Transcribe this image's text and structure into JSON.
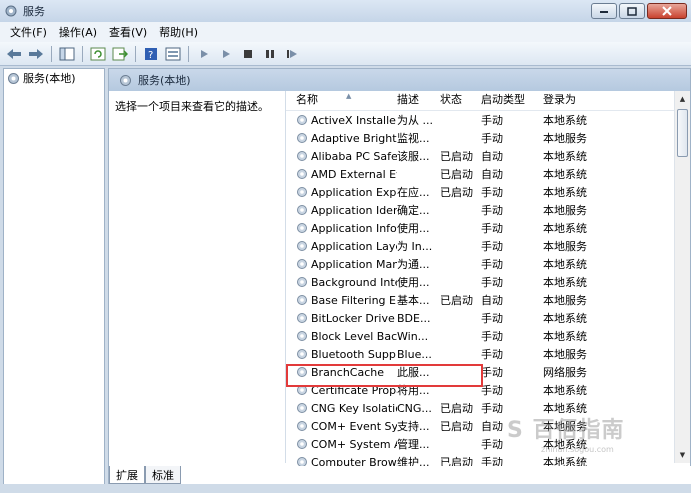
{
  "window": {
    "title": "服务"
  },
  "menu": [
    "文件(F)",
    "操作(A)",
    "查看(V)",
    "帮助(H)"
  ],
  "tree": {
    "root_label": "服务(本地)"
  },
  "pane": {
    "header_label": "服务(本地)",
    "description_prompt": "选择一个项目来查看它的描述。"
  },
  "columns": {
    "name": "名称",
    "desc": "描述",
    "state": "状态",
    "startup": "启动类型",
    "logon": "登录为"
  },
  "services": [
    {
      "name": "ActiveX Installer ...",
      "desc": "为从 ...",
      "state": "",
      "startup": "手动",
      "logon": "本地系统"
    },
    {
      "name": "Adaptive Brightn...",
      "desc": "监视...",
      "state": "",
      "startup": "手动",
      "logon": "本地服务"
    },
    {
      "name": "Alibaba PC Safe ...",
      "desc": "该服...",
      "state": "已启动",
      "startup": "自动",
      "logon": "本地系统"
    },
    {
      "name": "AMD External Ev...",
      "desc": "",
      "state": "已启动",
      "startup": "自动",
      "logon": "本地系统"
    },
    {
      "name": "Application Expe...",
      "desc": "在应...",
      "state": "已启动",
      "startup": "手动",
      "logon": "本地系统"
    },
    {
      "name": "Application Iden...",
      "desc": "确定...",
      "state": "",
      "startup": "手动",
      "logon": "本地服务"
    },
    {
      "name": "Application Infor...",
      "desc": "使用...",
      "state": "",
      "startup": "手动",
      "logon": "本地系统"
    },
    {
      "name": "Application Laye...",
      "desc": "为 In...",
      "state": "",
      "startup": "手动",
      "logon": "本地服务"
    },
    {
      "name": "Application Man...",
      "desc": "为通...",
      "state": "",
      "startup": "手动",
      "logon": "本地系统"
    },
    {
      "name": "Background Inte...",
      "desc": "使用...",
      "state": "",
      "startup": "手动",
      "logon": "本地系统"
    },
    {
      "name": "Base Filtering En...",
      "desc": "基本...",
      "state": "已启动",
      "startup": "自动",
      "logon": "本地服务"
    },
    {
      "name": "BitLocker Drive ...",
      "desc": "BDE...",
      "state": "",
      "startup": "手动",
      "logon": "本地系统"
    },
    {
      "name": "Block Level Back...",
      "desc": "Win...",
      "state": "",
      "startup": "手动",
      "logon": "本地系统"
    },
    {
      "name": "Bluetooth Supp...",
      "desc": "Blue...",
      "state": "",
      "startup": "手动",
      "logon": "本地服务"
    },
    {
      "name": "BranchCache",
      "desc": "此服...",
      "state": "",
      "startup": "手动",
      "logon": "网络服务"
    },
    {
      "name": "Certificate Propa...",
      "desc": "将用...",
      "state": "",
      "startup": "手动",
      "logon": "本地系统"
    },
    {
      "name": "CNG Key Isolation",
      "desc": "CNG...",
      "state": "已启动",
      "startup": "手动",
      "logon": "本地系统"
    },
    {
      "name": "COM+ Event Sys...",
      "desc": "支持...",
      "state": "已启动",
      "startup": "自动",
      "logon": "本地服务"
    },
    {
      "name": "COM+ System A...",
      "desc": "管理...",
      "state": "",
      "startup": "手动",
      "logon": "本地系统"
    },
    {
      "name": "Computer Brow...",
      "desc": "维护...",
      "state": "已启动",
      "startup": "手动",
      "logon": "本地系统"
    }
  ],
  "tabs": [
    "扩展",
    "标准"
  ],
  "watermark": {
    "main": "S 百佰指南",
    "sub": "zhinan.sogou.com"
  }
}
